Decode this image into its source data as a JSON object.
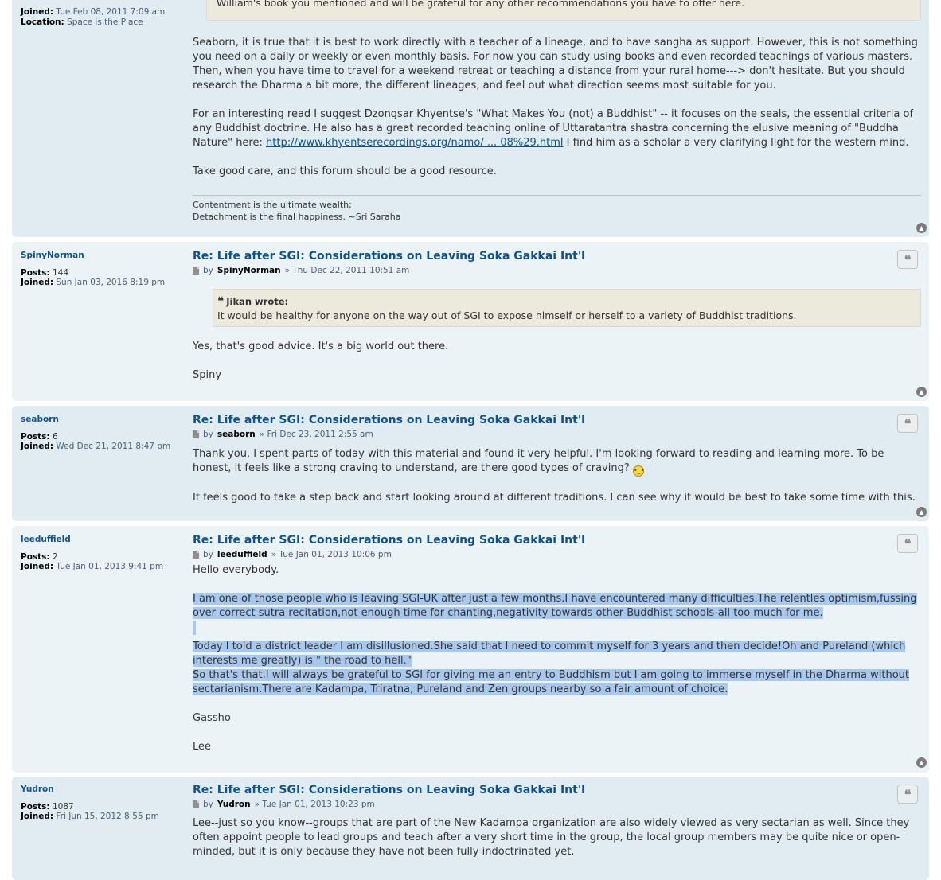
{
  "post1": {
    "profile": {
      "joined_label": "Joined:",
      "joined": "Tue Feb 08, 2011 7:09 am",
      "location_label": "Location:",
      "location": "Space is the Place"
    },
    "quote_tail": "William's book you mentioned and will be grateful for any other recommendations you have to offer here.",
    "para1": "Seaborn, it is true that it is best to work directly with a teacher of a lineage, and to have sangha as support. However, this is not something you need on a daily or weekly or even monthly basis. For now you can study using books and even recorded teachings of various masters. Then, when you have time to travel for a weekend retreat or teaching a distance from your rural home---> don't hesitate. But you should research the Dharma a bit more, the different lineages, and feel out what direction seems most suitable for you.",
    "para2_a": "For an interesting read I suggest Dzongsar Khyentse's \"What Makes You (not) a Buddhist\" -- it focuses on the seals, the essential criteria of any Buddhist doctrine. He also has a great recorded teaching online of Uttaratantra shastra concerning the elusive meaning of \"Buddha Nature\" here: ",
    "para2_link": "http://www.khyentserecordings.org/namo/ ... 08%29.html",
    "para2_b": " I find him as a scholar a very clarifying light for the western mind.",
    "para3": "Take good care, and this forum should be a good resource.",
    "sig1": "Contentment is the ultimate wealth;",
    "sig2": "Detachment is the final happiness. ~Sri Saraha"
  },
  "post2": {
    "username": "SpinyNorman",
    "posts_label": "Posts:",
    "posts": "144",
    "joined_label": "Joined:",
    "joined": "Sun Jan 03, 2016 8:19 pm",
    "title": "Re: Life after SGI: Considerations on Leaving Soka Gakkai Int'l",
    "by": "by",
    "author": "SpinyNorman",
    "date": "» Thu Dec 22, 2011 10:51 am",
    "quote_cite": "Jikan wrote:",
    "quote_text": "It would be healthy for anyone on the way out of SGI to expose himself or herself to a variety of Buddhist traditions.",
    "para1": "Yes, that's good advice. It's a big world out there.",
    "para2": "Spiny"
  },
  "post3": {
    "username": "seaborn",
    "posts_label": "Posts:",
    "posts": "6",
    "joined_label": "Joined:",
    "joined": "Wed Dec 21, 2011 8:47 pm",
    "title": "Re: Life after SGI: Considerations on Leaving Soka Gakkai Int'l",
    "by": "by",
    "author": "seaborn",
    "date": "» Fri Dec 23, 2011 2:55 am",
    "para1": "Thank you, I spent parts of today with this material and found it very helpful. I'm looking forward to reading and learning more. To be honest, it feels like a strong craving to understand, are there good types of craving?",
    "para2": "It feels good to take a step back and start looking around at different traditions. I can see why it would be best to take some time with this."
  },
  "post4": {
    "username": "leeduffield",
    "posts_label": "Posts:",
    "posts": "2",
    "joined_label": "Joined:",
    "joined": "Tue Jan 01, 2013 9:41 pm",
    "title": "Re: Life after SGI: Considerations on Leaving Soka Gakkai Int'l",
    "by": "by",
    "author": "leeduffield",
    "date": "» Tue Jan 01, 2013 10:06 pm",
    "para1": "Hello everybody.",
    "para2": "I am one of those people who is leaving SGI-UK after just a few months.I have encountered many difficulties.The relentles optimism,fussing over correct sutra recitation,not enough time for chanting,negativity towards other Buddhist schools-all too much for me.",
    "para3a": "Today I told a district leader I am disillusioned.She said that I need to commit myself for 3 years and then decide!Oh and Pureland (which interests me greatly) is \" the road to hell.\"",
    "para3b": "So that's that.I will always be grateful to SGI for giving me an entry to Buddhism but I am going to immerse myself in the Dharma without sectarianism.There are Kadampa, Triratna, Pureland and Zen groups nearby so a fair amount of choice.",
    "para4": "Gassho",
    "para5": "Lee"
  },
  "post5": {
    "username": "Yudron",
    "posts_label": "Posts:",
    "posts": "1087",
    "joined_label": "Joined:",
    "joined": "Fri Jun 15, 2012 8:55 pm",
    "title": "Re: Life after SGI: Considerations on Leaving Soka Gakkai Int'l",
    "by": "by",
    "author": "Yudron",
    "date": "» Tue Jan 01, 2013 10:23 pm",
    "para1": "Lee--just so you know--groups that are part of the New Kadampa organization are also widely viewed as very sectarian as well. Since they often appoint people to lead groups and teach after a very short time in the group, the local group members may be quite nice or open-minded, but it is only because they have not been fully indoctrinated yet."
  },
  "icons": {
    "quote": "quote-icon",
    "top": "back-to-top-icon",
    "post": "post-file-icon",
    "smiley": "smiley-icon"
  }
}
